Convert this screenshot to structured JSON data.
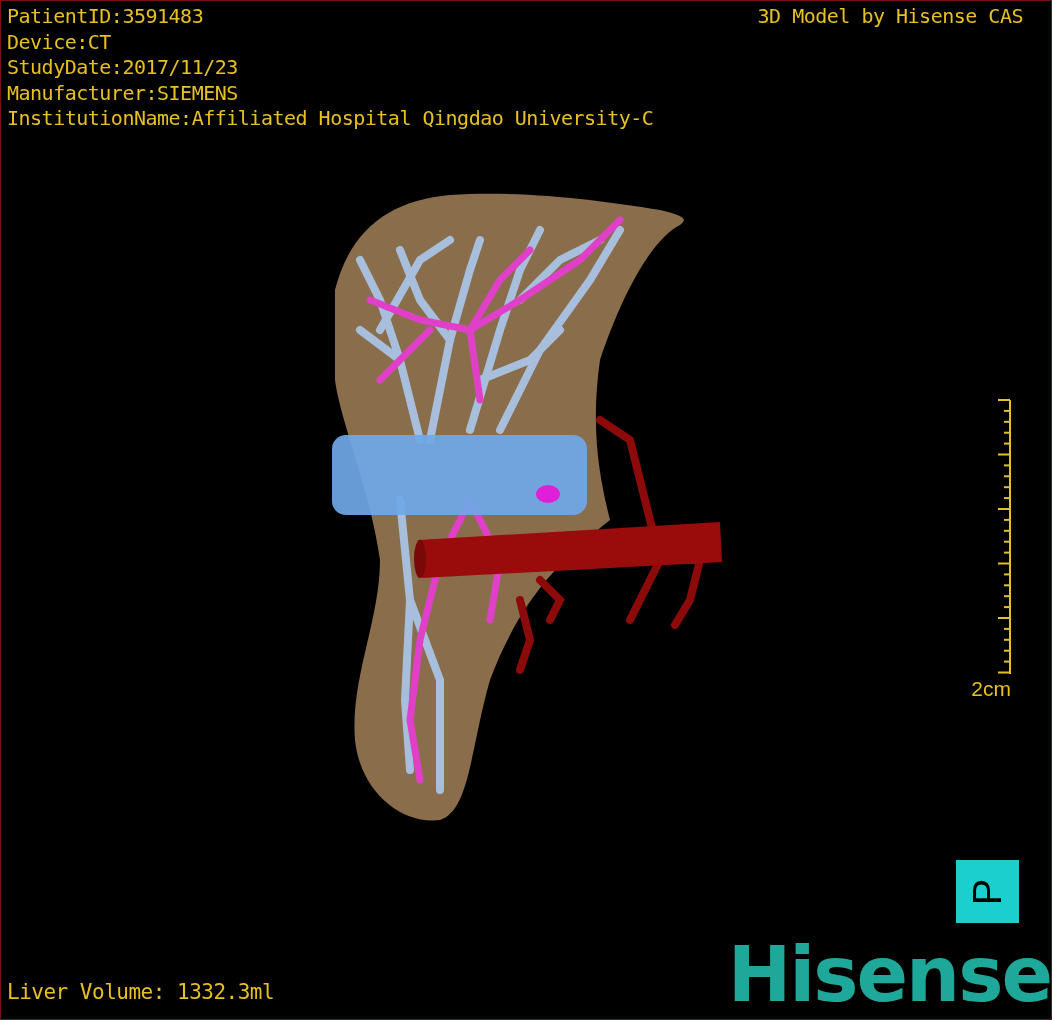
{
  "study_info": [
    "PatientID:3591483",
    "Device:CT",
    "StudyDate:2017/11/23",
    "Manufacturer:SIEMENS",
    "InstitutionName:Affiliated Hospital Qingdao University-C"
  ],
  "model_credit": "3D Model by Hisense CAS",
  "scale_bar": {
    "label": "2cm"
  },
  "orientation_marker": {
    "letter": "P"
  },
  "liver_volume": "Liver Volume: 1332.3ml",
  "logo": "Hisense"
}
